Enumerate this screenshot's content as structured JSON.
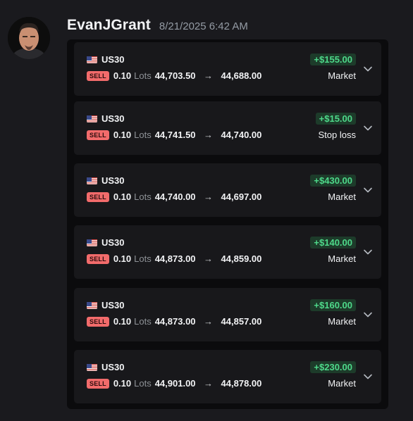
{
  "message": {
    "author": "EvanJGrant",
    "timestamp": "8/21/2025 6:42 AM"
  },
  "colors": {
    "pnl_text": "#4ed98a",
    "pnl_bg": "#1d3b2a",
    "sell_badge": "#f26b6b",
    "card_bg": "#18181b",
    "panel_bg": "#0b0b0d"
  },
  "trades": [
    {
      "symbol": "US30",
      "side": "SELL",
      "lots": "0.10",
      "lots_label": "Lots",
      "entry": "44,703.50",
      "exit": "44,688.00",
      "pnl": "+$155.00",
      "close_type": "Market"
    },
    {
      "symbol": "US30",
      "side": "SELL",
      "lots": "0.10",
      "lots_label": "Lots",
      "entry": "44,741.50",
      "exit": "44,740.00",
      "pnl": "+$15.00",
      "close_type": "Stop loss"
    },
    {
      "symbol": "US30",
      "side": "SELL",
      "lots": "0.10",
      "lots_label": "Lots",
      "entry": "44,740.00",
      "exit": "44,697.00",
      "pnl": "+$430.00",
      "close_type": "Market"
    },
    {
      "symbol": "US30",
      "side": "SELL",
      "lots": "0.10",
      "lots_label": "Lots",
      "entry": "44,873.00",
      "exit": "44,859.00",
      "pnl": "+$140.00",
      "close_type": "Market"
    },
    {
      "symbol": "US30",
      "side": "SELL",
      "lots": "0.10",
      "lots_label": "Lots",
      "entry": "44,873.00",
      "exit": "44,857.00",
      "pnl": "+$160.00",
      "close_type": "Market"
    },
    {
      "symbol": "US30",
      "side": "SELL",
      "lots": "0.10",
      "lots_label": "Lots",
      "entry": "44,901.00",
      "exit": "44,878.00",
      "pnl": "+$230.00",
      "close_type": "Market"
    }
  ]
}
